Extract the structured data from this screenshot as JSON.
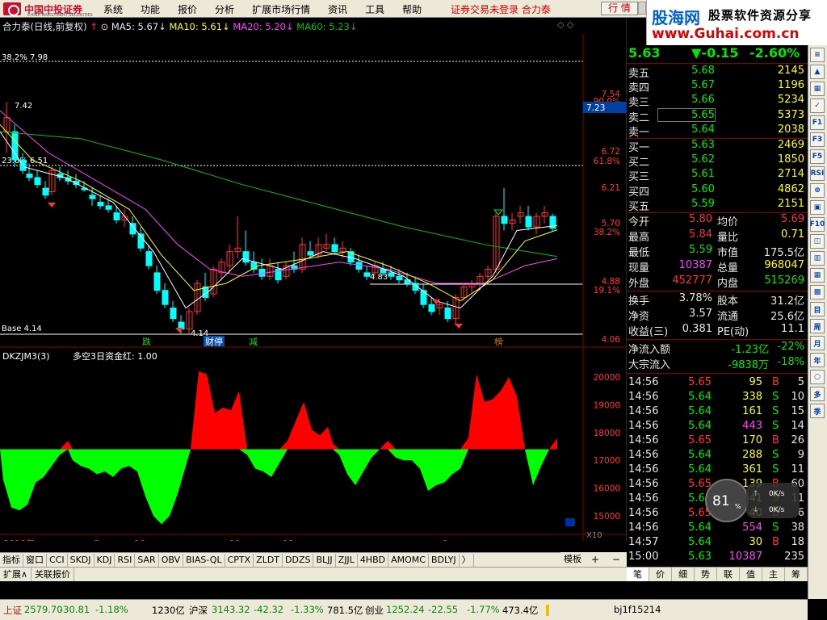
{
  "menubar": {
    "logo_text": "中国中投证券",
    "logo_sub": "CHINA INVESTMENT SECURITIES",
    "items": [
      "系统",
      "功能",
      "报价",
      "分析",
      "扩展市场行情",
      "资讯",
      "工具",
      "帮助"
    ],
    "status": "证券交易未登录 合力泰",
    "quote_button": "行 情"
  },
  "brand": {
    "name": "股海网",
    "slogan": "股票软件资源分享",
    "url": "www.Guhai.com.cn"
  },
  "chart": {
    "title": "合力泰(日线,前复权)",
    "ma5": "MA5: 5.67",
    "ma10": "MA10: 5.61",
    "ma20": "MA20: 5.20",
    "ma60": "MA60: 5.23",
    "right_top": "◇ ◇",
    "fib_382_top": "38.2% 7.98",
    "fib_236": "23.6% 6.51",
    "base": "Base 4.14",
    "high_mark": "7.42",
    "low_mark": "4.14",
    "mid_mark": "4.83",
    "price_box": "7.23",
    "y_axis": [
      "7.54",
      "90.0%",
      "6.72",
      "61.8%",
      "6.21",
      "5.70",
      "38.2%",
      "4.88",
      "19.1%",
      "4.06"
    ],
    "markers": [
      "跌",
      "财停",
      "减",
      "榜"
    ],
    "indicator_title": "DKZJM3(3)",
    "indicator_series": "多空3日资金红: 1.00",
    "ind_axis": [
      "20000",
      "19000",
      "18000",
      "17000",
      "16000",
      "15000"
    ],
    "ind_scale": "X10",
    "x_axis": [
      "2018年",
      "9",
      "10",
      "11",
      "12",
      "1"
    ],
    "colors": {
      "up": "#ff3232",
      "down": "#00ffff",
      "ma5": "#ffffff",
      "ma10": "#ffff00",
      "ma20": "#ff40ff",
      "ma60": "#00c000"
    }
  },
  "bottom_tabs": [
    "指标",
    "窗口",
    "CCI",
    "SKDJ",
    "KDJ",
    "RSI",
    "SAR",
    "OBV",
    "BIAS-QL",
    "CPTX",
    "ZLDT",
    "DDZS",
    "BLJJ",
    "ZJJL",
    "4HBD",
    "AMOMC",
    "BDLYJ",
    "〉"
  ],
  "mode_label": "模板",
  "mode_extra": [
    "+",
    "−"
  ],
  "period": "日线",
  "extra_tabs": [
    "扩展∧",
    "关联报价"
  ],
  "quote": {
    "price": "5.63",
    "change": "▼-0.15",
    "pct": "-2.60%",
    "asks": [
      {
        "label": "卖五",
        "price": "5.68",
        "vol": "2145"
      },
      {
        "label": "卖四",
        "price": "5.67",
        "vol": "1196"
      },
      {
        "label": "卖三",
        "price": "5.66",
        "vol": "5234"
      },
      {
        "label": "卖二",
        "price": "5.65",
        "vol": "5373"
      },
      {
        "label": "卖一",
        "price": "5.64",
        "vol": "2038"
      }
    ],
    "bids": [
      {
        "label": "买一",
        "price": "5.63",
        "vol": "2469"
      },
      {
        "label": "买二",
        "price": "5.62",
        "vol": "1850"
      },
      {
        "label": "买三",
        "price": "5.61",
        "vol": "2714"
      },
      {
        "label": "买四",
        "price": "5.60",
        "vol": "4862"
      },
      {
        "label": "买五",
        "price": "5.59",
        "vol": "2151"
      }
    ],
    "stats": [
      [
        "今开",
        "5.80",
        "均价",
        "5.69"
      ],
      [
        "最高",
        "5.84",
        "量比",
        "0.71"
      ],
      [
        "最低",
        "5.59",
        "市值",
        "175.5亿"
      ],
      [
        "现量",
        "10387",
        "总量",
        "968047"
      ],
      [
        "外盘",
        "452777",
        "内盘",
        "515269"
      ]
    ],
    "stats2": [
      [
        "换手",
        "3.78%",
        "股本",
        "31.2亿"
      ],
      [
        "净资",
        "3.57",
        "流通",
        "25.6亿"
      ],
      [
        "收益(三)",
        "0.381",
        "PE(动)",
        "11.1"
      ]
    ],
    "flow": [
      [
        "净流入额",
        "-1.23亿",
        "-22%"
      ],
      [
        "大宗流入",
        "-9838万",
        "-18%"
      ]
    ],
    "ticks": [
      [
        "14:56",
        "5.65",
        "95",
        "B",
        "5"
      ],
      [
        "14:56",
        "5.64",
        "338",
        "S",
        "10"
      ],
      [
        "14:56",
        "5.64",
        "161",
        "S",
        "15"
      ],
      [
        "14:56",
        "5.64",
        "443",
        "S",
        "14"
      ],
      [
        "14:56",
        "5.65",
        "170",
        "B",
        "26"
      ],
      [
        "14:56",
        "5.64",
        "288",
        "S",
        "9"
      ],
      [
        "14:56",
        "5.64",
        "361",
        "S",
        "11"
      ],
      [
        "14:56",
        "5.65",
        "139",
        "B",
        "60"
      ],
      [
        "14:56",
        "5.64",
        "341",
        "S",
        "11"
      ],
      [
        "14:56",
        "5.65",
        "40",
        "B",
        "6"
      ],
      [
        "14:56",
        "5.64",
        "554",
        "S",
        "38"
      ],
      [
        "14:57",
        "5.64",
        "30",
        "B",
        "18"
      ],
      [
        "15:00",
        "5.63",
        "10387",
        "",
        "235"
      ]
    ],
    "tabs": [
      "笔",
      "价",
      "细",
      "势",
      "联",
      "值",
      "主",
      "筹"
    ]
  },
  "gauge": {
    "value": "81",
    "unit": "%",
    "up": "0K/s",
    "down": "0K/s"
  },
  "toolbar": [
    "≡",
    "▲",
    "▦",
    "✓",
    "F1",
    "F3",
    "F5",
    "RSI",
    "⊕",
    "▣",
    "F10",
    "◫",
    "▥",
    "▦",
    "▩",
    "目",
    "周",
    "月",
    "年",
    "○",
    "多",
    "季"
  ],
  "statusbar": {
    "sh_label": "上证",
    "sh": "2579.70",
    "sh_chg": "-30.81",
    "sh_pct": "-1.18%",
    "sh_amt": "1230亿",
    "sz_label": "沪深",
    "sz": "3143.32",
    "sz_chg": "-42.32",
    "sz_pct": "-1.33%",
    "sz_amt": "781.5亿",
    "cy_label": "创业",
    "cy": "1252.24",
    "cy_chg": "-22.55",
    "cy_pct": "-1.77%",
    "cy_amt": "473.4亿",
    "code": "bj1f15214"
  }
}
